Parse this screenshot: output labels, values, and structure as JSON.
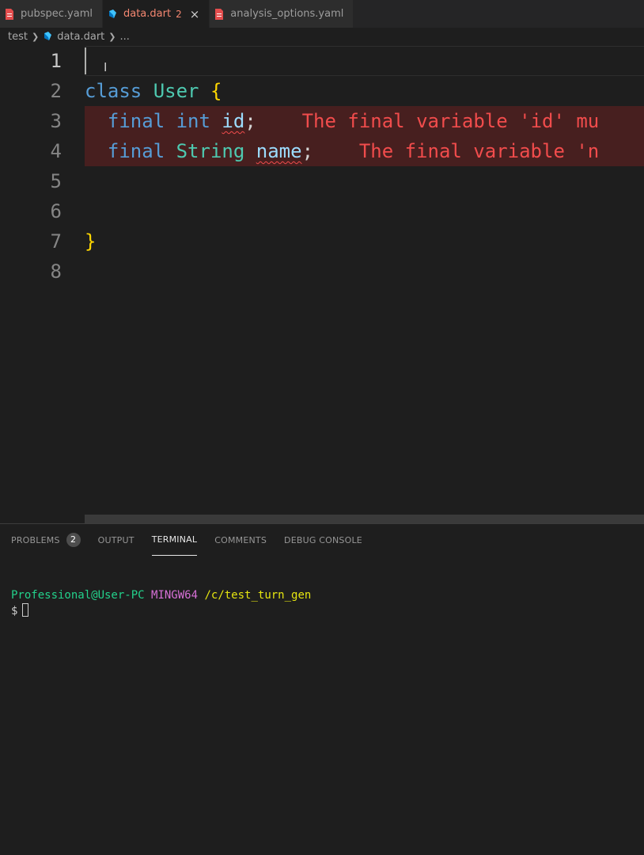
{
  "colors": {
    "error": "#f14c4c",
    "tab_error": "#f48771",
    "keyword": "#569cd6",
    "type": "#4ec9b0",
    "bracket": "#ffd700",
    "variable": "#9cdcfe"
  },
  "tabs": [
    {
      "label": "pubspec.yaml",
      "icon": "yaml-file-icon"
    },
    {
      "label": "data.dart",
      "badge": "2",
      "icon": "dart-file-icon",
      "close": "×"
    },
    {
      "label": "analysis_options.yaml",
      "icon": "yaml-file-icon"
    }
  ],
  "breadcrumb": {
    "folder": "test",
    "file": "data.dart",
    "more": "..."
  },
  "editor": {
    "line_numbers": [
      "1",
      "2",
      "3",
      "4",
      "5",
      "6",
      "7",
      "8"
    ],
    "line2": {
      "kw": "class",
      "name": "User",
      "brace": "{"
    },
    "line3": {
      "kw": "final",
      "type": "int",
      "var": "id",
      "semi": ";",
      "error": "The final variable 'id' mu"
    },
    "line4": {
      "kw": "final",
      "type": "String",
      "var": "name",
      "semi": ";",
      "error": "The final variable 'n"
    },
    "line7": {
      "brace": "}"
    }
  },
  "panel": {
    "tabs": [
      "PROBLEMS",
      "OUTPUT",
      "TERMINAL",
      "COMMENTS",
      "DEBUG CONSOLE"
    ],
    "problems_count": "2",
    "active_tab": "TERMINAL"
  },
  "terminal": {
    "user": "Professional@User-PC",
    "env": "MINGW64",
    "path": "/c/test_turn_gen",
    "prompt": "$"
  }
}
